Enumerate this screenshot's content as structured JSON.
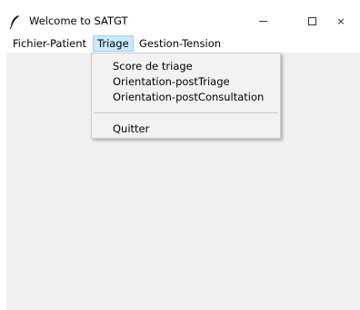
{
  "window": {
    "title": "Welcome to SATGT",
    "controls": {
      "minimize_icon": "minimize-icon",
      "maximize_icon": "maximize-icon",
      "close_glyph": "×"
    }
  },
  "menubar": {
    "items": [
      {
        "label": "Fichier-Patient"
      },
      {
        "label": "Triage"
      },
      {
        "label": "Gestion-Tension"
      }
    ]
  },
  "dropdown": {
    "items": [
      {
        "label": "Score de triage"
      },
      {
        "label": "Orientation-postTriage"
      },
      {
        "label": "Orientation-postConsultation"
      },
      {
        "label": "Quitter"
      }
    ]
  },
  "colors": {
    "menu_highlight": "#cce8ff",
    "menu_highlight_border": "#99d1ff",
    "client_background": "#f0f0f0"
  }
}
